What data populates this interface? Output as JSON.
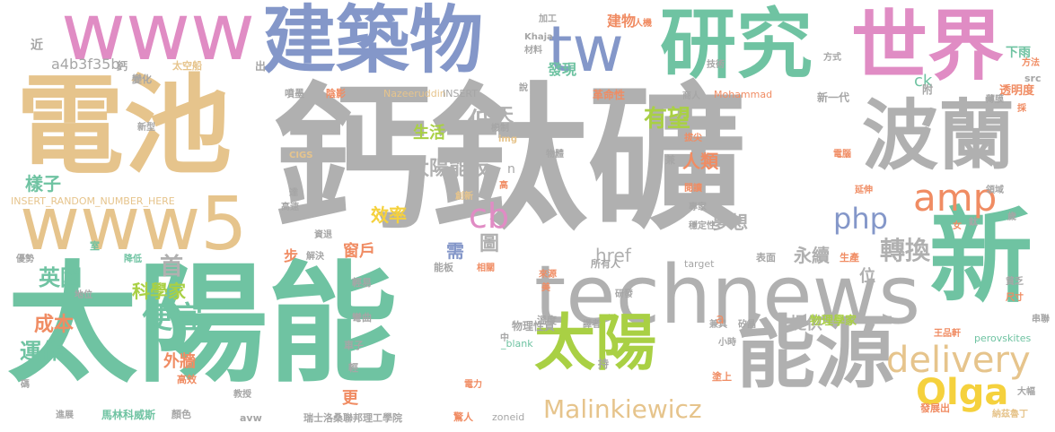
{
  "palette": {
    "gray": "#b0b0b0",
    "green": "#6fc3a2",
    "tan": "#e6c48c",
    "blue": "#8497c9",
    "pink": "#e08cc4",
    "lime": "#a9d044",
    "orange": "#f08c63",
    "yellow": "#f5d13d",
    "dgray": "#a6a6a6"
  },
  "words": [
    {
      "text": "鈣鈦礦",
      "color": "gray"
    },
    {
      "text": "太陽能",
      "color": "green"
    },
    {
      "text": "電池",
      "color": "tan"
    },
    {
      "text": "technews",
      "color": "gray"
    },
    {
      "text": "www5",
      "color": "tan"
    },
    {
      "text": "新",
      "color": "green"
    },
    {
      "text": "建築物",
      "color": "blue"
    },
    {
      "text": "www",
      "color": "pink"
    },
    {
      "text": "研究",
      "color": "green"
    },
    {
      "text": "世界",
      "color": "pink"
    },
    {
      "text": "tw",
      "color": "blue"
    },
    {
      "text": "波蘭",
      "color": "gray"
    },
    {
      "text": "能源",
      "color": "gray"
    },
    {
      "text": "太陽",
      "color": "lime"
    },
    {
      "text": "delivery",
      "color": "tan"
    },
    {
      "text": "Olga",
      "color": "yellow"
    },
    {
      "text": "Malinkiewicz",
      "color": "tan"
    },
    {
      "text": "amp",
      "color": "orange"
    },
    {
      "text": "php",
      "color": "blue"
    },
    {
      "text": "cb",
      "color": "pink"
    },
    {
      "text": "太陽能板",
      "color": "gray"
    },
    {
      "text": "低",
      "color": "gray"
    },
    {
      "text": "天",
      "color": "gray"
    },
    {
      "text": "有望",
      "color": "lime"
    },
    {
      "text": "人類",
      "color": "orange"
    },
    {
      "text": "轉換",
      "color": "gray"
    },
    {
      "text": "效率",
      "color": "yellow"
    },
    {
      "text": "窗戶",
      "color": "orange"
    },
    {
      "text": "夢想",
      "color": "gray"
    },
    {
      "text": "永續",
      "color": "gray"
    },
    {
      "text": "href",
      "color": "gray"
    },
    {
      "text": "需",
      "color": "blue"
    },
    {
      "text": "圖",
      "color": "gray"
    },
    {
      "text": "首",
      "color": "gray"
    },
    {
      "text": "便宜",
      "color": "green"
    },
    {
      "text": "英國",
      "color": "green"
    },
    {
      "text": "科學家",
      "color": "lime"
    },
    {
      "text": "成本",
      "color": "orange"
    },
    {
      "text": "運作",
      "color": "green"
    },
    {
      "text": "外牆",
      "color": "orange"
    },
    {
      "text": "提供",
      "color": "gray"
    },
    {
      "text": "位",
      "color": "gray"
    },
    {
      "text": "樣子",
      "color": "green"
    },
    {
      "text": "生活",
      "color": "lime"
    },
    {
      "text": "發現",
      "color": "green"
    },
    {
      "text": "建物",
      "color": "orange"
    },
    {
      "text": "下雨",
      "color": "green"
    },
    {
      "text": "ck",
      "color": "green"
    },
    {
      "text": "a4b3f35b",
      "color": "gray"
    },
    {
      "text": "INSERT_RANDOM_NUMBER_HERE",
      "color": "tan"
    },
    {
      "text": "perovskites",
      "color": "green"
    },
    {
      "text": "馬林科威斯",
      "color": "green"
    },
    {
      "text": "瑞士洛桑聯邦理工學院",
      "color": "gray"
    },
    {
      "text": "Nazeeruddin",
      "color": "tan"
    },
    {
      "text": "INSERT",
      "color": "gray"
    },
    {
      "text": "Mohammad",
      "color": "orange"
    },
    {
      "text": "物理學家",
      "color": "lime"
    },
    {
      "text": "物理性質",
      "color": "gray"
    },
    {
      "text": "革命性",
      "color": "orange"
    },
    {
      "text": "新一代",
      "color": "gray"
    },
    {
      "text": "透明度",
      "color": "orange"
    },
    {
      "text": "太空船",
      "color": "tan"
    },
    {
      "text": "所有人",
      "color": "gray"
    },
    {
      "text": "target",
      "color": "gray"
    },
    {
      "text": "_blank",
      "color": "green"
    },
    {
      "text": "zoneid",
      "color": "gray"
    },
    {
      "text": "發展出",
      "color": "orange"
    },
    {
      "text": "納茲魯丁",
      "color": "tan"
    },
    {
      "text": "王品軒",
      "color": "orange"
    },
    {
      "text": "穩定性",
      "color": "gray"
    },
    {
      "text": "創新",
      "color": "tan"
    },
    {
      "text": "電力",
      "color": "orange"
    },
    {
      "text": "驚人",
      "color": "orange"
    },
    {
      "text": "大幅",
      "color": "gray"
    },
    {
      "text": "生產",
      "color": "orange"
    },
    {
      "text": "表面",
      "color": "gray"
    },
    {
      "text": "商人",
      "color": "gray"
    },
    {
      "text": "陰影",
      "color": "orange"
    },
    {
      "text": "噴墨",
      "color": "gray"
    },
    {
      "text": "加工",
      "color": "gray"
    },
    {
      "text": "人機",
      "color": "orange"
    },
    {
      "text": "技術",
      "color": "gray"
    },
    {
      "text": "方式",
      "color": "gray"
    },
    {
      "text": "方法",
      "color": "orange"
    },
    {
      "text": "src",
      "color": "gray"
    },
    {
      "text": "變化",
      "color": "gray"
    },
    {
      "text": "新型",
      "color": "gray"
    },
    {
      "text": "CIGS",
      "color": "tan"
    },
    {
      "text": "img",
      "color": "tan"
    },
    {
      "text": "機制",
      "color": "gray"
    },
    {
      "text": "物體",
      "color": "gray"
    },
    {
      "text": "拔尖",
      "color": "orange"
    },
    {
      "text": "電腦",
      "color": "orange"
    },
    {
      "text": "閱讀",
      "color": "orange"
    },
    {
      "text": "專家",
      "color": "gray"
    },
    {
      "text": "延伸",
      "color": "orange"
    },
    {
      "text": "領域",
      "color": "gray"
    },
    {
      "text": "高速",
      "color": "gray"
    },
    {
      "text": "資退",
      "color": "gray"
    },
    {
      "text": "室",
      "color": "green"
    },
    {
      "text": "優勢",
      "color": "gray"
    },
    {
      "text": "降低",
      "color": "green"
    },
    {
      "text": "解決",
      "color": "gray"
    },
    {
      "text": "輕易",
      "color": "gray"
    },
    {
      "text": "能板",
      "color": "gray"
    },
    {
      "text": "相關",
      "color": "orange"
    },
    {
      "text": "來源",
      "color": "orange"
    },
    {
      "text": "地位",
      "color": "gray"
    },
    {
      "text": "彎曲",
      "color": "gray"
    },
    {
      "text": "研發",
      "color": "gray"
    },
    {
      "text": "溫度",
      "color": "gray"
    },
    {
      "text": "譯者",
      "color": "gray"
    },
    {
      "text": "兼具",
      "color": "gray"
    },
    {
      "text": "矽晶",
      "color": "gray"
    },
    {
      "text": "小時",
      "color": "gray"
    },
    {
      "text": "串聯",
      "color": "gray"
    },
    {
      "text": "尺寸",
      "color": "orange"
    },
    {
      "text": "貧乏",
      "color": "gray"
    },
    {
      "text": "車子",
      "color": "gray"
    },
    {
      "text": "高效",
      "color": "orange"
    },
    {
      "text": "教授",
      "color": "gray"
    },
    {
      "text": "顏色",
      "color": "gray"
    },
    {
      "text": "進展",
      "color": "gray"
    },
    {
      "text": "塗上",
      "color": "orange"
    },
    {
      "text": "薄膜",
      "color": "gray"
    },
    {
      "text": "材料",
      "color": "gray"
    },
    {
      "text": "Khaja",
      "color": "gray"
    },
    {
      "text": "avw",
      "color": "gray"
    },
    {
      "text": "採",
      "color": "orange"
    },
    {
      "text": "附",
      "color": "gray"
    },
    {
      "text": "兼",
      "color": "gray"
    },
    {
      "text": "達",
      "color": "gray"
    },
    {
      "text": "更",
      "color": "orange"
    },
    {
      "text": "步",
      "color": "orange"
    },
    {
      "text": "a",
      "color": "orange"
    },
    {
      "text": "出",
      "color": "gray"
    },
    {
      "text": "說",
      "color": "gray"
    },
    {
      "text": "近",
      "color": "gray"
    },
    {
      "text": "n",
      "color": "gray"
    },
    {
      "text": "持",
      "color": "gray"
    },
    {
      "text": "輕",
      "color": "gray"
    },
    {
      "text": "中",
      "color": "gray"
    },
    {
      "text": "女",
      "color": "orange"
    },
    {
      "text": "歲",
      "color": "gray"
    },
    {
      "text": "鈦",
      "color": "gray"
    },
    {
      "text": "美",
      "color": "orange"
    },
    {
      "text": "鈣",
      "color": "gray"
    },
    {
      "text": "高",
      "color": "orange"
    },
    {
      "text": "碼",
      "color": "gray"
    }
  ]
}
